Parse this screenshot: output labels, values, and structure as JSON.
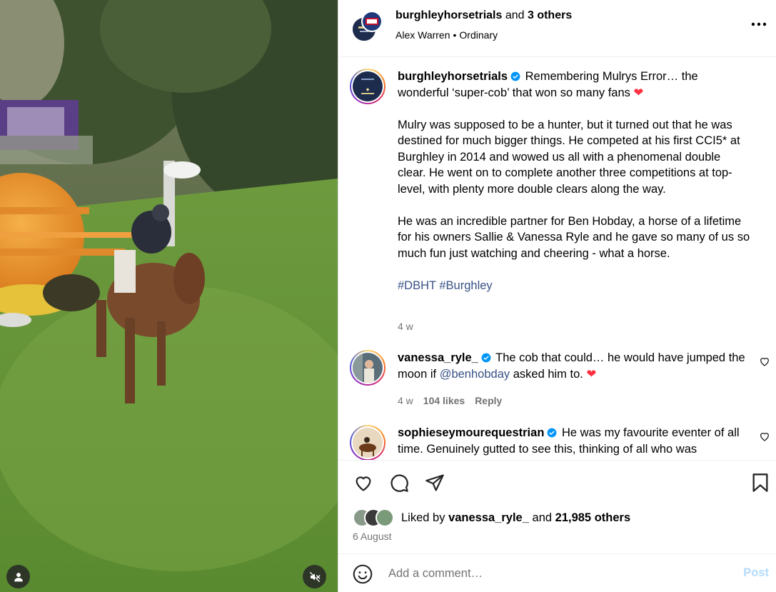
{
  "colors": {
    "link": "#385185",
    "heart": "#ff3040",
    "muted": "#737373",
    "post_disabled": "#b3dbff",
    "verified": "#0095f6"
  },
  "icons": {
    "tag": "user-tag-icon",
    "mute": "speaker-muted-icon",
    "more": "more-horizontal-icon",
    "verified": "verified-badge-icon",
    "like": "heart-outline-icon",
    "comment": "speech-bubble-icon",
    "share": "paper-plane-icon",
    "save": "bookmark-icon",
    "emoji": "emoji-smile-icon"
  },
  "header": {
    "username": "burghleyhorsetrials",
    "and_text": "and",
    "others": "3 others",
    "audio": "Alex Warren",
    "separator": "•",
    "audio_track": "Ordinary"
  },
  "caption": {
    "username": "burghleyhorsetrials",
    "intro": "Remembering Mulrys Error… the wonderful ‘super-cob’ that won so many fans",
    "emoji": "❤",
    "para1": "Mulry was supposed to be a hunter, but it turned out that he was destined for much bigger things. He competed at his first CCI5* at Burghley in 2014 and wowed us all with a phenomenal double clear. He went on to complete another three competitions at top-level, with plenty more double clears along the way.",
    "para2": "He was an incredible partner for Ben Hobday, a horse of a lifetime for his owners Sallie & Vanessa Ryle and he gave so many of us so much fun just watching and cheering - what a horse.",
    "hashtags": "#DBHT #Burghley",
    "time": "4 w"
  },
  "comments": [
    {
      "username": "vanessa_ryle_",
      "text_before": "The cob that could… he would have jumped the moon if",
      "mention": "@benhobday",
      "text_after": "asked him to.",
      "emoji": "❤",
      "time": "4 w",
      "likes": "104 likes",
      "reply": "Reply"
    },
    {
      "username": "sophieseymourequestrian",
      "text": "He was my favourite eventer of all time. Genuinely gutted to see this, thinking of all who was"
    }
  ],
  "likes": {
    "prefix": "Liked by",
    "user": "vanessa_ryle_",
    "conj": "and",
    "others": "21,985 others"
  },
  "date": "6 August",
  "add_comment": {
    "placeholder": "Add a comment…",
    "post": "Post"
  }
}
